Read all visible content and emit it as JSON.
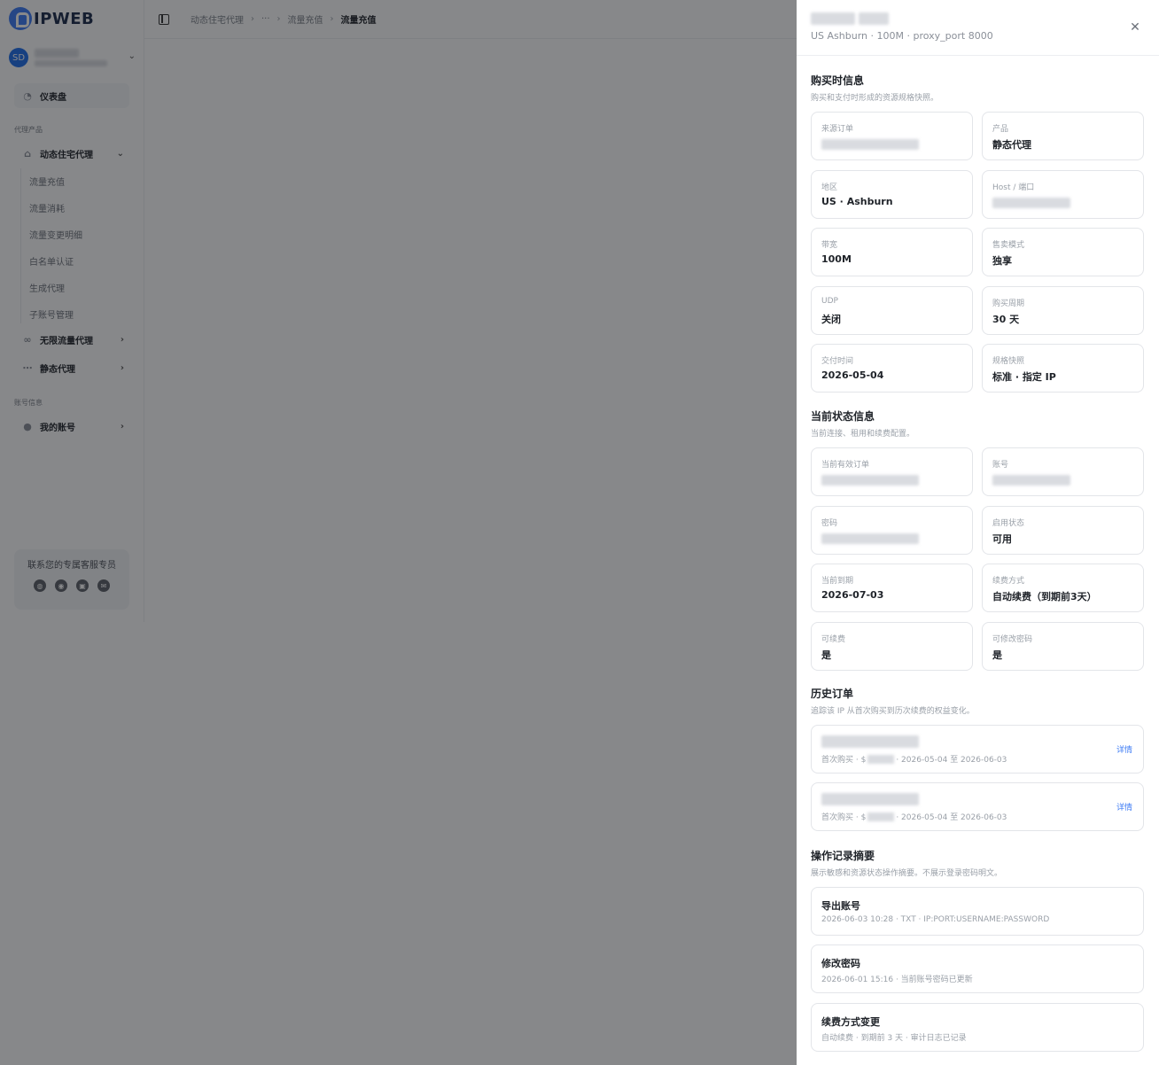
{
  "logo": {
    "text": "IPWEB"
  },
  "user": {
    "avatar_initials": "SD"
  },
  "sidebar": {
    "dashboard_label": "仪表盘",
    "group_proxy_label": "代理产品",
    "dynamic_residential": {
      "label": "动态住宅代理",
      "children": [
        "流量充值",
        "流量消耗",
        "流量变更明细",
        "白名单认证",
        "生成代理",
        "子账号管理"
      ]
    },
    "unlimited_label": "无限流量代理",
    "static_label": "静态代理",
    "group_account_label": "账号信息",
    "my_account_label": "我的账号",
    "contact_title": "联系您的专属客服专员"
  },
  "header": {
    "breadcrumb": [
      "动态住宅代理",
      "···",
      "流量充值",
      "流量充值"
    ]
  },
  "drawer": {
    "subtitle": "US Ashburn · 100M · proxy_port 8000",
    "purchase": {
      "title": "购买时信息",
      "desc": "购买和支付时形成的资源规格快照。",
      "fields": [
        {
          "label": "来源订单",
          "value": ""
        },
        {
          "label": "产品",
          "value": "静态代理"
        },
        {
          "label": "地区",
          "value": "US · Ashburn"
        },
        {
          "label": "Host / 端口",
          "value": ""
        },
        {
          "label": "带宽",
          "value": "100M"
        },
        {
          "label": "售卖模式",
          "value": "独享"
        },
        {
          "label": "UDP",
          "value": "关闭"
        },
        {
          "label": "购买周期",
          "value": "30 天"
        },
        {
          "label": "交付时间",
          "value": "2026-05-04"
        },
        {
          "label": "规格快照",
          "value": "标准 · 指定 IP"
        }
      ]
    },
    "current": {
      "title": "当前状态信息",
      "desc": "当前连接、租用和续费配置。",
      "fields": [
        {
          "label": "当前有效订单",
          "value": ""
        },
        {
          "label": "账号",
          "value": ""
        },
        {
          "label": "密码",
          "value": ""
        },
        {
          "label": "启用状态",
          "value": "可用"
        },
        {
          "label": "当前到期",
          "value": "2026-07-03"
        },
        {
          "label": "续费方式",
          "value": "自动续费（到期前3天）"
        },
        {
          "label": "可续费",
          "value": "是"
        },
        {
          "label": "可修改密码",
          "value": "是"
        }
      ]
    },
    "history": {
      "title": "历史订单",
      "desc": "追踪该 IP 从首次购买到历次续费的权益变化。",
      "orders": [
        {
          "type": "首次购买 · $",
          "period": "· 2026-05-04 至 2026-06-03",
          "detail": "详情"
        },
        {
          "type": "首次购买 · $",
          "period": "· 2026-05-04 至 2026-06-03",
          "detail": "详情"
        }
      ]
    },
    "operations": {
      "title": "操作记录摘要",
      "desc": "展示敏感和资源状态操作摘要。不展示登录密码明文。",
      "items": [
        {
          "title": "导出账号",
          "meta": "2026-06-03 10:28 · TXT · IP:PORT:USERNAME:PASSWORD"
        },
        {
          "title": "修改密码",
          "meta": "2026-06-01 15:16 · 当前账号密码已更新"
        },
        {
          "title": "续费方式变更",
          "meta": "自动续费 · 到期前 3 天 · 审计日志已记录"
        }
      ]
    }
  }
}
